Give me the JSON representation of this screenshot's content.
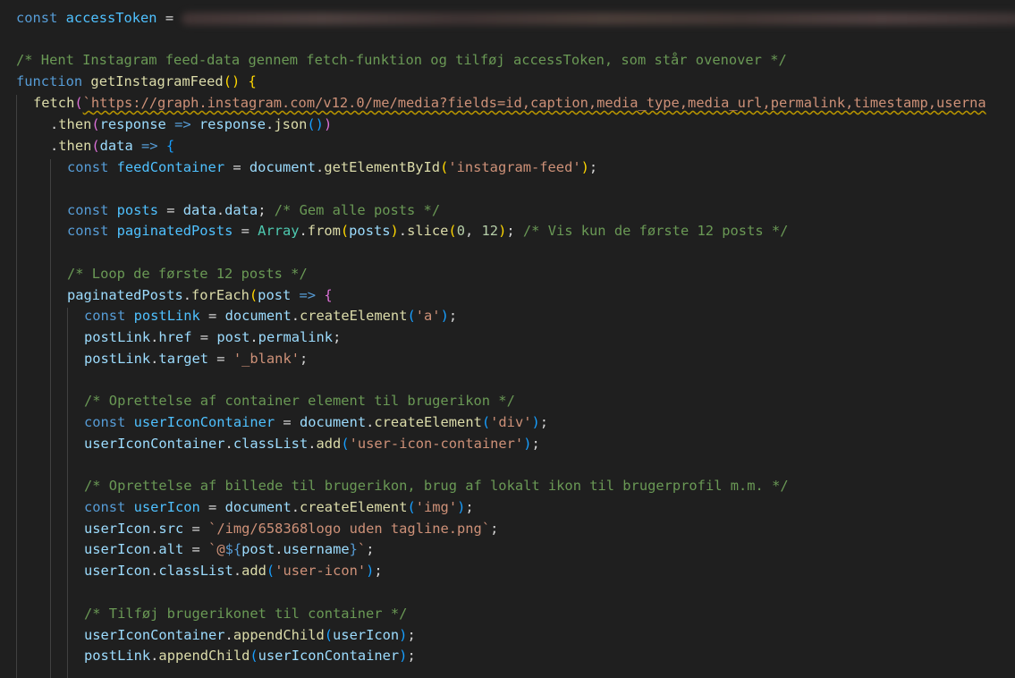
{
  "code": {
    "l1_kw": "const",
    "l1_name": "accessToken",
    "l1_eq": " = ",
    "l3_comment": "/* Hent Instagram feed-data gennem fetch-funktion og tilføj accessToken, som står ovenover */",
    "l4_kw": "function",
    "l4_name": "getInstagramFeed",
    "l5_fetch": "fetch",
    "l5_tick": "`",
    "l5_url": "https://graph.instagram.com/v12.0/me/media?fields=id,caption,media_type,media_url,permalink,timestamp,userna",
    "l6_then": "then",
    "l6_response": "response",
    "l6_json": "json",
    "l7_data": "data",
    "l8_const": "const",
    "l8_name": "feedContainer",
    "l8_document": "document",
    "l8_method": "getElementById",
    "l8_arg": "'instagram-feed'",
    "l10_name": "posts",
    "l10_comment": "/* Gem alle posts */",
    "l11_name": "paginatedPosts",
    "l11_array": "Array",
    "l11_from": "from",
    "l11_slice": "slice",
    "l11_n0": "0",
    "l11_n12": "12",
    "l11_comment": "/* Vis kun de første 12 posts */",
    "l13_comment": "/* Loop de første 12 posts */",
    "l14_forEach": "forEach",
    "l14_post": "post",
    "l15_name": "postLink",
    "l15_create": "createElement",
    "l15_arg": "'a'",
    "l16_href": "href",
    "l16_permalink": "permalink",
    "l17_target": "target",
    "l17_val": "'_blank'",
    "l19_comment": "/* Oprettelse af container element til brugerikon */",
    "l20_name": "userIconContainer",
    "l20_arg": "'div'",
    "l21_classList": "classList",
    "l21_add": "add",
    "l21_arg": "'user-icon-container'",
    "l23_comment": "/* Oprettelse af billede til brugerikon, brug af lokalt ikon til brugerprofil m.m. */",
    "l24_name": "userIcon",
    "l24_arg": "'img'",
    "l25_src": "src",
    "l25_val": "`/img/658368logo uden tagline.png`",
    "l26_alt": "alt",
    "l26_tick": "`@",
    "l26_dollar": "${",
    "l26_username": "username",
    "l26_close": "}",
    "l26_tick2": "`",
    "l27_arg": "'user-icon'",
    "l29_comment": "/* Tilføj brugerikonet til container */",
    "l30_append": "appendChild"
  }
}
